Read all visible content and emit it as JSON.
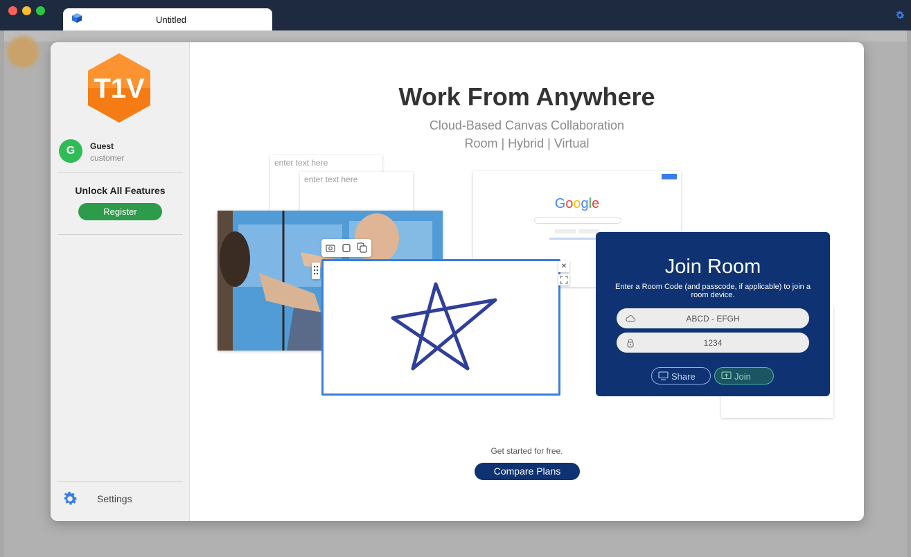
{
  "window_tab": {
    "title": "Untitled"
  },
  "sidebar": {
    "avatar_initial": "G",
    "user_name": "Guest",
    "user_role": "customer",
    "unlock_label": "Unlock All Features",
    "register_label": "Register",
    "settings_label": "Settings"
  },
  "hero": {
    "headline": "Work From Anywhere",
    "subtitle_1": "Cloud-Based Canvas Collaboration",
    "subtitle_2": "Room | Hybrid | Virtual"
  },
  "illustration": {
    "sticky_1_placeholder": "enter text here",
    "sticky_2_placeholder": "enter text here",
    "google_logo": "Google"
  },
  "join_room": {
    "title": "Join Room",
    "description": "Enter a Room Code (and passcode, if applicable) to join a room device.",
    "room_code": "ABCD - EFGH",
    "passcode": "1234",
    "share_label": "Share",
    "join_label": "Join"
  },
  "footer": {
    "get_started": "Get started for free.",
    "compare_label": "Compare Plans"
  },
  "colors": {
    "titlebar": "#1e2a3f",
    "accent_navy": "#0f3372",
    "register_green": "#2c9c4b",
    "canvas_border": "#3a7de0",
    "logo_orange": "#f57c14"
  }
}
